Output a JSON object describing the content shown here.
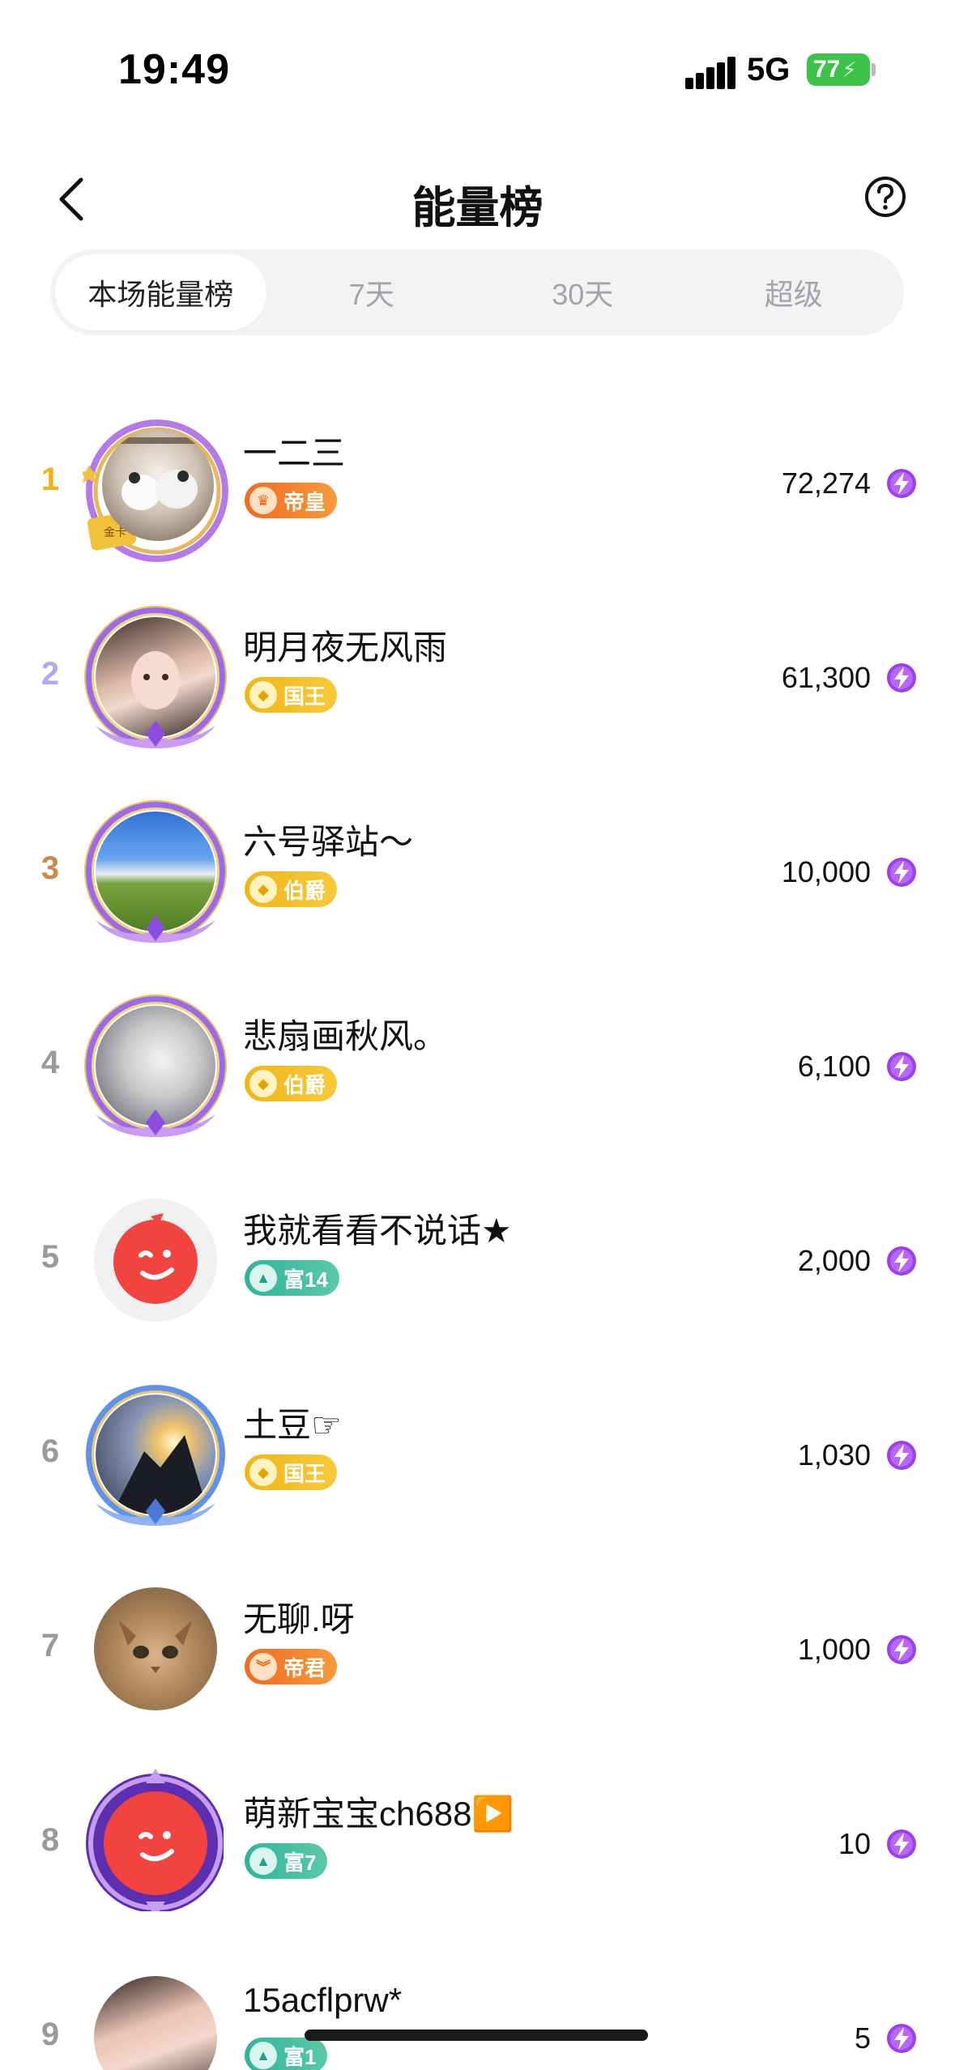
{
  "status_bar": {
    "time": "19:49",
    "network": "5G",
    "battery": "77"
  },
  "header": {
    "title": "能量榜"
  },
  "tabs": [
    {
      "label": "本场能量榜",
      "active": true
    },
    {
      "label": "7天",
      "active": false
    },
    {
      "label": "30天",
      "active": false
    },
    {
      "label": "超级",
      "active": false
    }
  ],
  "colors": {
    "rank1": "#f2b11a",
    "rank2": "#b3a6f2",
    "rank3": "#c98a4b",
    "rank_other": "#9a9a9a",
    "energy_icon": "#9b3ff0"
  },
  "ranking": [
    {
      "rank": "1",
      "name": "一二三",
      "badge": "帝皇",
      "badge_style": "orange",
      "score": "72,274",
      "avatar": "pandas-photo",
      "frame": "gold-crown"
    },
    {
      "rank": "2",
      "name": "明月夜无风雨",
      "badge": "国王",
      "badge_style": "gold",
      "score": "61,300",
      "avatar": "girl-photo",
      "frame": "purple"
    },
    {
      "rank": "3",
      "name": "六号驿站～",
      "badge": "伯爵",
      "badge_style": "gold",
      "score": "10,000",
      "avatar": "landscape-photo",
      "frame": "purple"
    },
    {
      "rank": "4",
      "name": "悲扇画秋风。",
      "badge": "伯爵",
      "badge_style": "gold",
      "score": "6,100",
      "avatar": "anime-photo",
      "frame": "purple"
    },
    {
      "rank": "5",
      "name": "我就看看不说话★",
      "badge": "富14",
      "badge_style": "green",
      "score": "2,000",
      "avatar": "default-red-face",
      "frame": "none"
    },
    {
      "rank": "6",
      "name": "土豆☞",
      "badge": "国王",
      "badge_style": "gold",
      "score": "1,030",
      "avatar": "climbers-photo",
      "frame": "blue"
    },
    {
      "rank": "7",
      "name": "无聊.呀",
      "badge": "帝君",
      "badge_style": "orange",
      "score": "1,000",
      "avatar": "cat-photo",
      "frame": "none"
    },
    {
      "rank": "8",
      "name": "萌新宝宝ch688▶️",
      "badge": "富7",
      "badge_style": "green",
      "score": "10",
      "avatar": "default-red-face",
      "frame": "purple-armor"
    },
    {
      "rank": "9",
      "name": "15acflprw*",
      "badge": "富1",
      "badge_style": "green",
      "score": "5",
      "avatar": "woman-photo",
      "frame": "none"
    }
  ]
}
